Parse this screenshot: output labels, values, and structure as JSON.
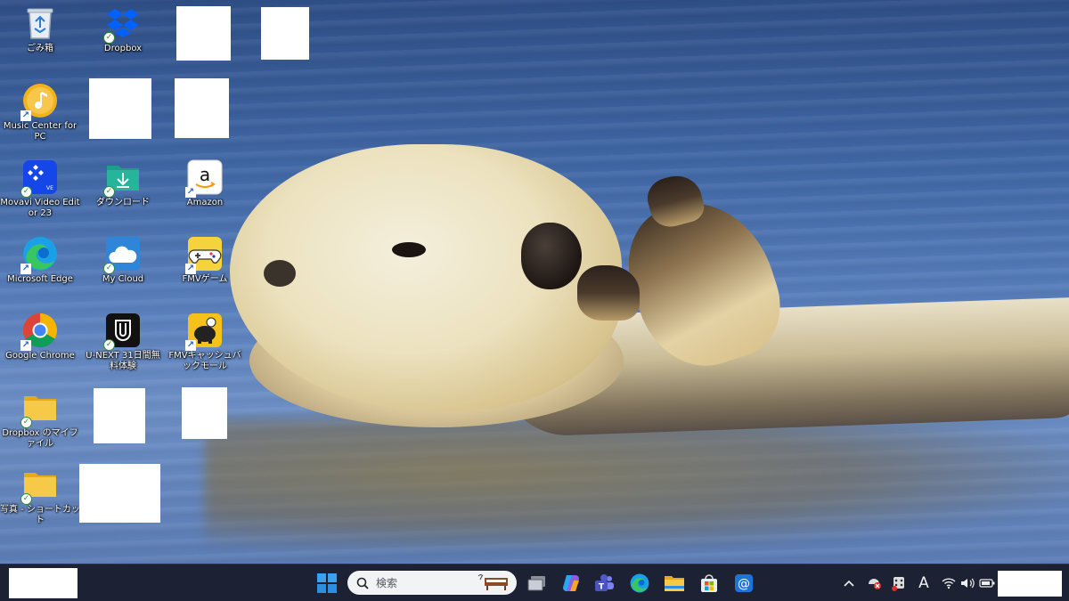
{
  "desktop": {
    "icons": [
      {
        "id": "recycle-bin",
        "label": "ごみ箱",
        "icon": "recycle-bin-icon"
      },
      {
        "id": "dropbox",
        "label": "Dropbox",
        "icon": "dropbox-icon"
      },
      {
        "id": "music-center",
        "label": "Music Center for PC",
        "icon": "music-center-icon"
      },
      {
        "id": "movavi",
        "label": "Movavi Video Editor 23",
        "icon": "movavi-icon"
      },
      {
        "id": "download",
        "label": "ダウンロード",
        "icon": "download-folder-icon"
      },
      {
        "id": "amazon",
        "label": "Amazon",
        "icon": "amazon-icon"
      },
      {
        "id": "edge",
        "label": "Microsoft Edge",
        "icon": "edge-icon"
      },
      {
        "id": "mycloud",
        "label": "My Cloud",
        "icon": "cloud-icon"
      },
      {
        "id": "fmv-game",
        "label": "FMVゲーム",
        "icon": "gamepad-icon"
      },
      {
        "id": "chrome",
        "label": "Google Chrome",
        "icon": "chrome-icon"
      },
      {
        "id": "unext",
        "label": "U-NEXT 31日間無料体験",
        "icon": "unext-icon"
      },
      {
        "id": "fmv-cashback",
        "label": "FMVキャッシュバックモール",
        "icon": "piggy-bank-icon"
      },
      {
        "id": "dropbox-files",
        "label": "Dropbox のマイファイル",
        "icon": "folder-icon"
      },
      {
        "id": "photos-shortcut",
        "label": "写真 - ショートカット",
        "icon": "folder-icon"
      }
    ]
  },
  "taskbar": {
    "search_placeholder": "検索",
    "items": [
      "start-button",
      "search-box",
      "task-view",
      "copilot",
      "teams",
      "edge",
      "file-explorer",
      "microsoft-store",
      "mail"
    ],
    "tray": {
      "ime_indicator": "A",
      "overflow_glyph": "^"
    }
  },
  "colors": {
    "taskbar_bg": "#1c2233",
    "accent_blue": "#0078d4",
    "sync_green": "#2e8b3a"
  }
}
